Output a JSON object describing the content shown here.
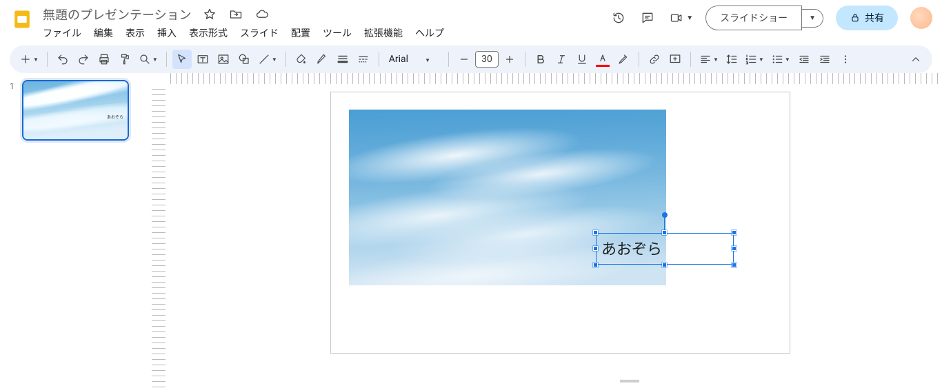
{
  "doc": {
    "title": "無題のプレゼンテーション"
  },
  "menu": [
    "ファイル",
    "編集",
    "表示",
    "挿入",
    "表示形式",
    "スライド",
    "配置",
    "ツール",
    "拡張機能",
    "ヘルプ"
  ],
  "buttons": {
    "slideshow": "スライドショー",
    "share": "共有"
  },
  "toolbar": {
    "font": "Arial",
    "fontSize": "30",
    "textColor": "#FF0000"
  },
  "slide": {
    "number": "1",
    "thumbText": "あおぞら",
    "textBox": "あおぞら"
  }
}
